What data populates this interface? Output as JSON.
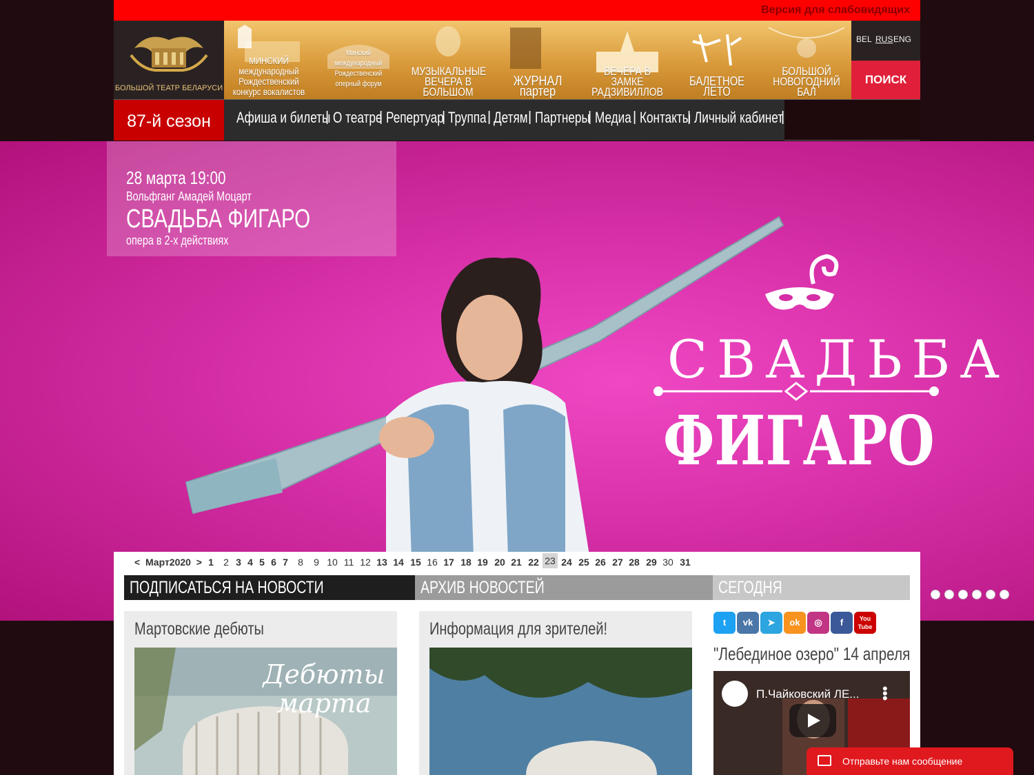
{
  "topbar": {
    "accessibility_link": "Версия для слабовидящих"
  },
  "header": {
    "logo_text": "БОЛЬШОЙ ТЕАТР БЕЛАРУСИ",
    "tiles": [
      {
        "caption": "МИНСКИЙ международный Рождественский конкурс вокалистов"
      },
      {
        "caption": "Минский международный Рождественский оперный форум"
      },
      {
        "caption": "МУЗЫКАЛЬНЫЕ ВЕЧЕРА В БОЛЬШОМ"
      },
      {
        "caption": "ЖУРНАЛ партер"
      },
      {
        "caption": "ВЕЧЕРА В ЗАМКЕ РАДЗИВИЛЛОВ"
      },
      {
        "caption": "БАЛЕТНОЕ ЛЕТО"
      },
      {
        "caption": "БОЛЬШОЙ НОВОГОДНИЙ БАЛ"
      }
    ],
    "languages": [
      "BEL",
      "RUS",
      "ENG"
    ],
    "active_language": "RUS",
    "search_label": "ПОИСК"
  },
  "nav": {
    "season": "87-й сезон",
    "items": [
      "Афиша и билеты",
      "О театре",
      "Репертуар",
      "Труппа",
      "Детям",
      "Партнеры",
      "Медиа",
      "Контакты",
      "Личный кабинет"
    ],
    "separator": "|"
  },
  "hero": {
    "date": "28 марта 19:00",
    "composer": "Вольфганг Амадей Моцарт",
    "title": "СВАДЬБА ФИГАРО",
    "subtitle": "опера в 2-х действиях",
    "poster_title_line1": "СВАДЬБА",
    "poster_title_line2": "ФИГАРО",
    "slides_count": 6
  },
  "calendar": {
    "prev": "<",
    "month": "Март2020",
    "next": ">",
    "days": [
      "1",
      "2",
      "3",
      "4",
      "5",
      "6",
      "7",
      "8",
      "9",
      "10",
      "11",
      "12",
      "13",
      "14",
      "15",
      "16",
      "17",
      "18",
      "19",
      "20",
      "21",
      "22",
      "23",
      "24",
      "25",
      "26",
      "27",
      "28",
      "29",
      "30",
      "31"
    ],
    "bold_days": [
      "1",
      "3",
      "4",
      "5",
      "6",
      "7",
      "13",
      "14",
      "15",
      "17",
      "18",
      "19",
      "20",
      "21",
      "22",
      "24",
      "25",
      "26",
      "27",
      "28",
      "29",
      "31"
    ],
    "today": "23"
  },
  "sections": {
    "subscribe": "ПОДПИСАТЬСЯ НА НОВОСТИ",
    "archive": "АРХИВ НОВОСТЕЙ",
    "today": "СЕГОДНЯ"
  },
  "news": [
    {
      "title": "Мартовские дебюты",
      "image_text": "Дебюты марта"
    },
    {
      "title": "Информация для зрителей!"
    }
  ],
  "social": [
    {
      "name": "twitter-icon",
      "color": "#1da1f2",
      "glyph": "t"
    },
    {
      "name": "vk-icon",
      "color": "#4a76a8",
      "glyph": "vk"
    },
    {
      "name": "telegram-icon",
      "color": "#2ca5e0",
      "glyph": "➤"
    },
    {
      "name": "odnoklassniki-icon",
      "color": "#f7931e",
      "glyph": "ok"
    },
    {
      "name": "instagram-icon",
      "color": "#c13584",
      "glyph": "◎"
    },
    {
      "name": "facebook-icon",
      "color": "#3b5998",
      "glyph": "f"
    },
    {
      "name": "youtube-icon",
      "color": "#cc0000",
      "glyph": "You Tube"
    }
  ],
  "sidebar": {
    "event_title": "\"Лебединое озеро\" 14 апреля",
    "video_title": "П.Чайковский ЛЕ..."
  },
  "chat": {
    "label": "Отправьте нам сообщение"
  },
  "colors": {
    "accent_red": "#ff0000",
    "hero_pink": "#d52ea6",
    "season_red": "#c80000"
  }
}
